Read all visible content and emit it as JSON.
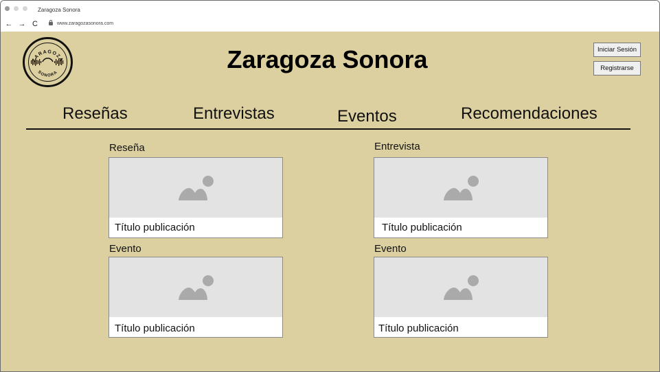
{
  "browser": {
    "tab_title": "Zaragoza Sonora",
    "url": "www.zaragozasonora.com",
    "back": "←",
    "forward": "→",
    "reload": "C"
  },
  "header": {
    "logo_text_top": "ZARAGOZA",
    "logo_text_bottom": "SONORA",
    "title": "Zaragoza Sonora",
    "login_label": "Iniciar Sesión",
    "register_label": "Registrarse"
  },
  "menu": {
    "items": [
      {
        "label": "Reseñas"
      },
      {
        "label": "Entrevistas"
      },
      {
        "label": "Eventos"
      },
      {
        "label": "Recomendaciones"
      }
    ]
  },
  "cards": [
    {
      "category": "Reseña",
      "title": "Título publicación"
    },
    {
      "category": "Entrevista",
      "title": "Título publicación"
    },
    {
      "category": "Evento",
      "title": "Título publicación"
    },
    {
      "category": "Evento",
      "title": "Título publicación"
    }
  ],
  "colors": {
    "page_background": "#dccfa0",
    "placeholder_background": "#e3e3e3",
    "placeholder_icon": "#aaaaaa"
  }
}
